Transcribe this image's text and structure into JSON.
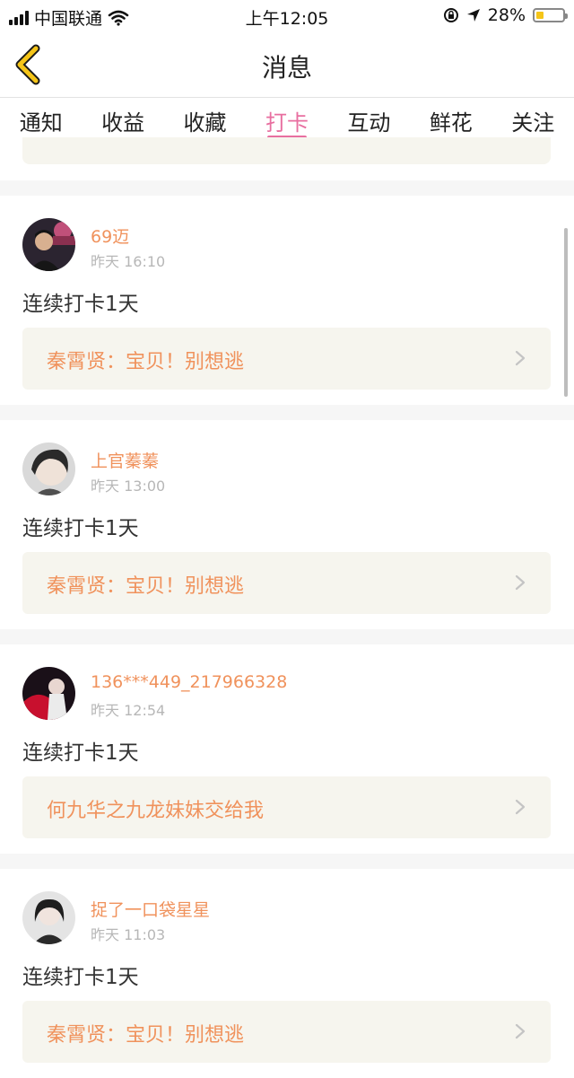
{
  "status_bar": {
    "carrier": "中国联通",
    "time": "上午12:05",
    "battery_percent": "28%",
    "battery_level": 0.28
  },
  "header": {
    "title": "消息"
  },
  "tabs": [
    {
      "label": "通知",
      "active": false
    },
    {
      "label": "收益",
      "active": false
    },
    {
      "label": "收藏",
      "active": false
    },
    {
      "label": "打卡",
      "active": true
    },
    {
      "label": "互动",
      "active": false
    },
    {
      "label": "鲜花",
      "active": false
    },
    {
      "label": "关注",
      "active": false
    }
  ],
  "messages": [
    {
      "user": "69迈",
      "time": "昨天 16:10",
      "content": "连续打卡1天",
      "quote": "秦霄贤：宝贝！别想逃"
    },
    {
      "user": "上官蓁蓁",
      "time": "昨天 13:00",
      "content": "连续打卡1天",
      "quote": "秦霄贤：宝贝！别想逃"
    },
    {
      "user": "136***449_217966328",
      "time": "昨天 12:54",
      "content": "连续打卡1天",
      "quote": "何九华之九龙妹妹交给我"
    },
    {
      "user": "捉了一口袋星星",
      "time": "昨天 11:03",
      "content": "连续打卡1天",
      "quote": "秦霄贤：宝贝！别想逃"
    }
  ],
  "colors": {
    "accent_pink": "#e86fa0",
    "username_orange": "#f0925c",
    "quote_bg": "#f6f5ee"
  },
  "icons": {
    "back": "chevron-left-icon",
    "quote_arrow": "chevron-right-icon",
    "wifi": "wifi-icon",
    "location": "location-arrow-icon",
    "rotation_lock": "rotation-lock-icon"
  }
}
